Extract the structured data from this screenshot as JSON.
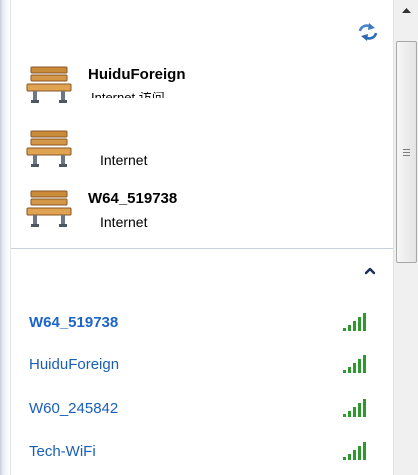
{
  "connected": [
    {
      "name": "HuiduForeign",
      "status": "Internet 访问"
    },
    {
      "name": "",
      "status": "Internet"
    },
    {
      "name": "W64_519738",
      "status": "Internet"
    }
  ],
  "networks": [
    {
      "name": "W64_519738",
      "signal_bars": 5,
      "bold": true
    },
    {
      "name": "HuiduForeign",
      "signal_bars": 5,
      "bold": false
    },
    {
      "name": "W60_245842",
      "signal_bars": 5,
      "bold": false
    },
    {
      "name": "Tech-WiFi",
      "signal_bars": 5,
      "bold": false
    }
  ],
  "icons": {
    "refresh": "refresh-icon",
    "bench": "bench-icon",
    "signal": "signal-strength-icon",
    "collapse": "chevron-up-icon"
  },
  "colors": {
    "network_link": "#1a5fb4",
    "signal_green": "#2e9a2e",
    "divider": "#c9d3de"
  }
}
